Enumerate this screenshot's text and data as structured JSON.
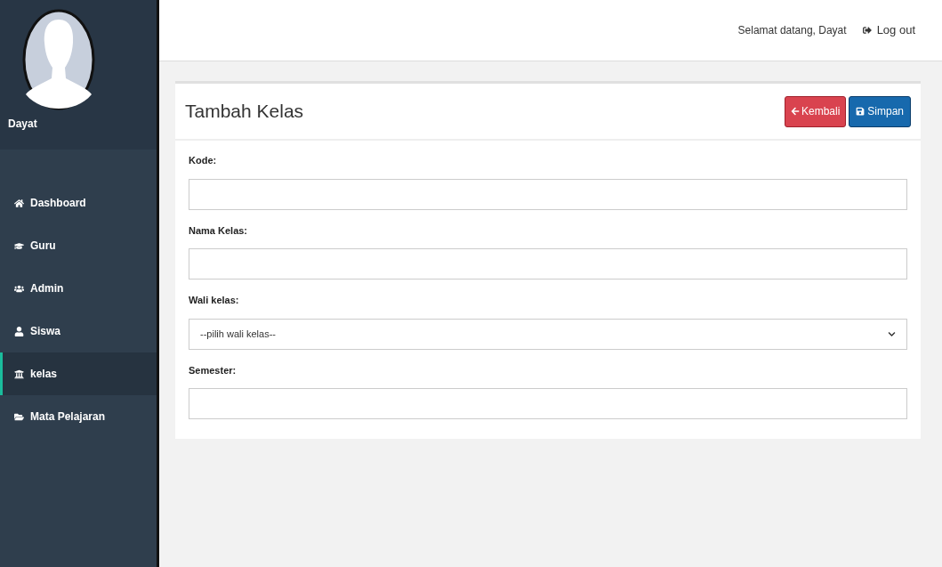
{
  "sidebar": {
    "user_name": "Dayat",
    "items": [
      {
        "label": "Dashboard",
        "selected": false
      },
      {
        "label": "Guru",
        "selected": false
      },
      {
        "label": "Admin",
        "selected": false
      },
      {
        "label": "Siswa",
        "selected": false
      },
      {
        "label": "kelas",
        "selected": true
      },
      {
        "label": "Mata Pelajaran",
        "selected": false
      }
    ]
  },
  "header": {
    "greeting": "Selamat datang, Dayat",
    "logout": "Log out"
  },
  "form": {
    "title": "Tambah Kelas",
    "buttons": [
      {
        "label": "Kembali",
        "kind": "back"
      },
      {
        "label": "Simpan",
        "kind": "save"
      }
    ],
    "fields": [
      {
        "label": "Kode:",
        "kind": "text"
      },
      {
        "label": "Nama Kelas:",
        "kind": "text"
      },
      {
        "label": "Wali kelas:",
        "kind": "select",
        "value": "--pilih wali kelas--"
      },
      {
        "label": "Semester:",
        "kind": "text"
      }
    ]
  }
}
